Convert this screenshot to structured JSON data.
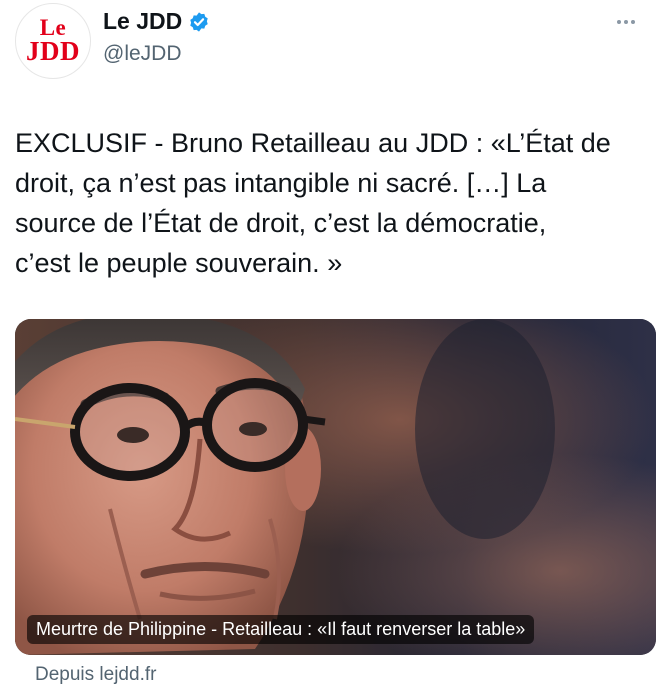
{
  "author": {
    "avatar_line1": "Le",
    "avatar_line2": "JDD",
    "name": "Le JDD",
    "handle": "@leJDD",
    "verified": true
  },
  "tweet": {
    "line1": "EXCLUSIF - Bruno Retailleau au JDD : «L’État de",
    "line2": "droit, ça n’est pas intangible ni sacré. […] La",
    "line3": "source de l’État de droit, c’est la démocratie,",
    "line4": "c’est le peuple souverain. »"
  },
  "card": {
    "caption": "Meurtre de Philippine - Retailleau : «Il faut renverser la table»",
    "source": "Depuis lejdd.fr"
  },
  "icons": {
    "more": "more-horizontal-icon",
    "verified": "verified-badge-icon"
  },
  "colors": {
    "brand_red": "#e2001a",
    "verified_blue": "#1d9bf0",
    "secondary_text": "#536471"
  }
}
